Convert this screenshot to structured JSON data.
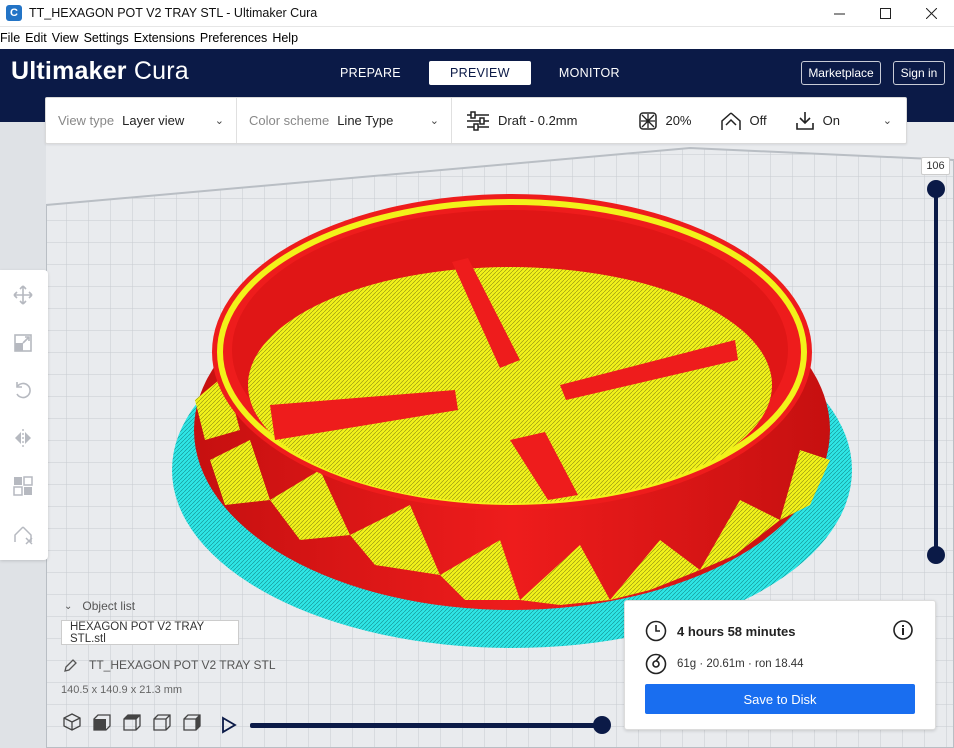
{
  "window": {
    "app_icon": "C",
    "title": "TT_HEXAGON POT V2 TRAY STL - Ultimaker Cura",
    "controls": {
      "minimize": "minimize-icon",
      "maximize": "maximize-icon",
      "close": "close-icon"
    }
  },
  "menubar": {
    "items": [
      "File",
      "Edit",
      "View",
      "Settings",
      "Extensions",
      "Preferences",
      "Help"
    ]
  },
  "header": {
    "brand_bold": "Ultimaker",
    "brand_light": "Cura",
    "stages": [
      "PREPARE",
      "PREVIEW",
      "MONITOR"
    ],
    "active_stage": "PREVIEW",
    "marketplace_label": "Marketplace",
    "signin_label": "Sign in",
    "bg_color": "#0b1a47"
  },
  "toolbar": {
    "view_type_label": "View type",
    "view_type_value": "Layer view",
    "color_scheme_label": "Color scheme",
    "color_scheme_value": "Line Type",
    "profile": "Draft - 0.2mm",
    "infill": "20%",
    "support": "Off",
    "adhesion": "On"
  },
  "layer_slider": {
    "max_layer": "106"
  },
  "object_list": {
    "header": "Object list",
    "file_field": "HEXAGON POT V2 TRAY STL.stl",
    "object_name": "TT_HEXAGON POT V2 TRAY STL",
    "dimensions": "140.5 x 140.9 x 21.3 mm"
  },
  "print_info": {
    "time": "4 hours 58 minutes",
    "material": "61g · 20.61m · ron 18.44",
    "save_label": "Save to Disk",
    "accent_color": "#196ef0"
  },
  "model_colors": {
    "wall": "#ee1c1c",
    "top": "#f2f21a",
    "skirt": "#2ee6e6"
  }
}
